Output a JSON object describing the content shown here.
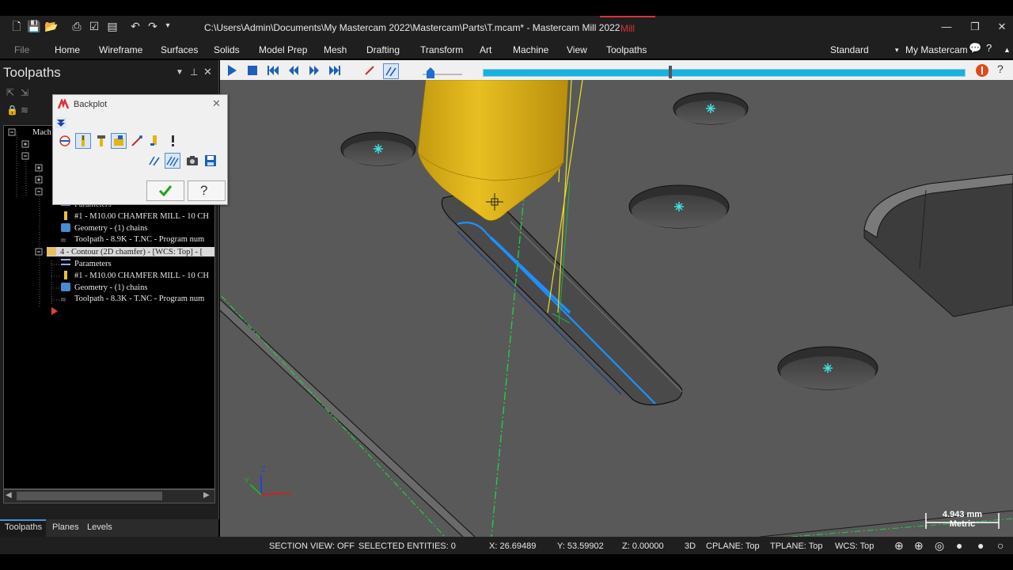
{
  "window": {
    "title": "C:\\Users\\Admin\\Documents\\My Mastercam 2022\\Mastercam\\Parts\\T.mcam* - Mastercam Mill 2022",
    "context_tab": "Mill"
  },
  "ribbon": {
    "tabs": [
      "File",
      "Home",
      "Wireframe",
      "Surfaces",
      "Solids",
      "Model Prep",
      "Mesh",
      "Drafting",
      "Transform",
      "Art",
      "Machine",
      "View",
      "Toolpaths"
    ],
    "workspace": "Standard",
    "my_mastercam": "My Mastercam"
  },
  "panel": {
    "title": "Toolpaths",
    "tree": [
      {
        "text": "Mach",
        "icon": "machine-icon"
      },
      {
        "text": "Parameters",
        "icon": "parameters-icon"
      },
      {
        "text": "#1 - M10.00 CHAMFER MILL - 10 CH",
        "icon": "tool-icon"
      },
      {
        "text": "Geometry - (1) chains",
        "icon": "geometry-icon"
      },
      {
        "text": "Toolpath - 8.9K - T.NC - Program num",
        "icon": "toolpath-icon"
      },
      {
        "text": "4 - Contour (2D chamfer) - [WCS: Top] - [",
        "icon": "folder-icon"
      },
      {
        "text": "Parameters",
        "icon": "parameters-icon"
      },
      {
        "text": "#1 - M10.00 CHAMFER MILL - 10 CH",
        "icon": "tool-icon"
      },
      {
        "text": "Geometry - (1) chains",
        "icon": "geometry-icon"
      },
      {
        "text": "Toolpath - 8.3K - T.NC - Program num",
        "icon": "toolpath-icon"
      }
    ],
    "bottom_tabs": [
      "Toolpaths",
      "Planes",
      "Levels"
    ]
  },
  "backplot": {
    "title": "Backplot",
    "progress": 0.39
  },
  "viewport": {
    "scale_value": "4.943 mm",
    "scale_unit": "Metric"
  },
  "status": {
    "section_view": "SECTION VIEW: OFF",
    "selected": "SELECTED ENTITIES: 0",
    "x": "X:  26.69489",
    "y": "Y:  53.59902",
    "z": "Z:  0.00000",
    "mode": "3D",
    "cplane": "CPLANE: Top",
    "tplane": "TPLANE: Top",
    "wcs": "WCS: Top"
  },
  "colors": {
    "accent_red": "#d9323d",
    "toolpath_blue": "#1e90ff",
    "tool_yellow": "#e2b514",
    "progress_cyan": "#1ab0e0"
  }
}
